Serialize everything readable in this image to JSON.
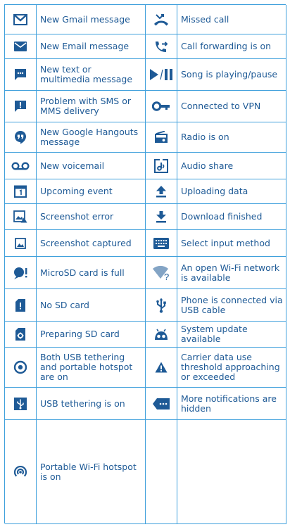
{
  "colors": {
    "icon": "#1e5a96",
    "rule": "#3fa0dc"
  },
  "left": [
    {
      "label": "New Gmail message",
      "icon": "gmail-icon"
    },
    {
      "label": "New Email message",
      "icon": "email-icon"
    },
    {
      "label": "New text or multimedia message",
      "icon": "text-message-icon"
    },
    {
      "label": "Problem with SMS or MMS delivery",
      "icon": "sms-problem-icon"
    },
    {
      "label": "New Google Hangouts message",
      "icon": "hangouts-icon"
    },
    {
      "label": "New voicemail",
      "icon": "voicemail-icon"
    },
    {
      "label": "Upcoming event",
      "icon": "calendar-icon"
    },
    {
      "label": "Screenshot error",
      "icon": "screenshot-error-icon"
    },
    {
      "label": " Screenshot captured",
      "icon": "screenshot-icon"
    },
    {
      "label": "MicroSD card is full",
      "icon": "sd-full-icon"
    },
    {
      "label": "No SD card",
      "icon": "no-sd-icon"
    },
    {
      "label": "Preparing SD card",
      "icon": "preparing-sd-icon"
    },
    {
      "label": "Both USB tethering and portable hotspot are on",
      "icon": "tether-hotspot-icon"
    },
    {
      "label": "USB tethering is on",
      "icon": "usb-tether-icon"
    },
    {
      "label": "Portable Wi-Fi hotspot is on",
      "icon": "hotspot-icon"
    }
  ],
  "right": [
    {
      "label": "Missed call",
      "icon": "missed-call-icon"
    },
    {
      "label": "Call forwarding is on",
      "icon": "call-forward-icon"
    },
    {
      "label": "Song is playing/pause",
      "icon": "play-pause-icon"
    },
    {
      "label": "Connected to VPN",
      "icon": "vpn-key-icon"
    },
    {
      "label": "Radio is on",
      "icon": "radio-icon"
    },
    {
      "label": "Audio share",
      "icon": "audio-share-icon"
    },
    {
      "label": "Uploading data",
      "icon": "upload-icon"
    },
    {
      "label": "Download finished",
      "icon": "download-icon"
    },
    {
      "label": "Select input method",
      "icon": "keyboard-icon"
    },
    {
      "label": "An open Wi-Fi network is available",
      "icon": "open-wifi-icon"
    },
    {
      "label": "Phone is connected via USB cable",
      "icon": "usb-icon"
    },
    {
      "label": "System update available",
      "icon": "system-update-icon"
    },
    {
      "label": "Carrier data use threshold approaching or exceeded",
      "icon": "data-warning-icon"
    },
    {
      "label": "More notifications are hidden",
      "icon": "more-notifications-icon"
    },
    {
      "label": "",
      "icon": ""
    }
  ]
}
